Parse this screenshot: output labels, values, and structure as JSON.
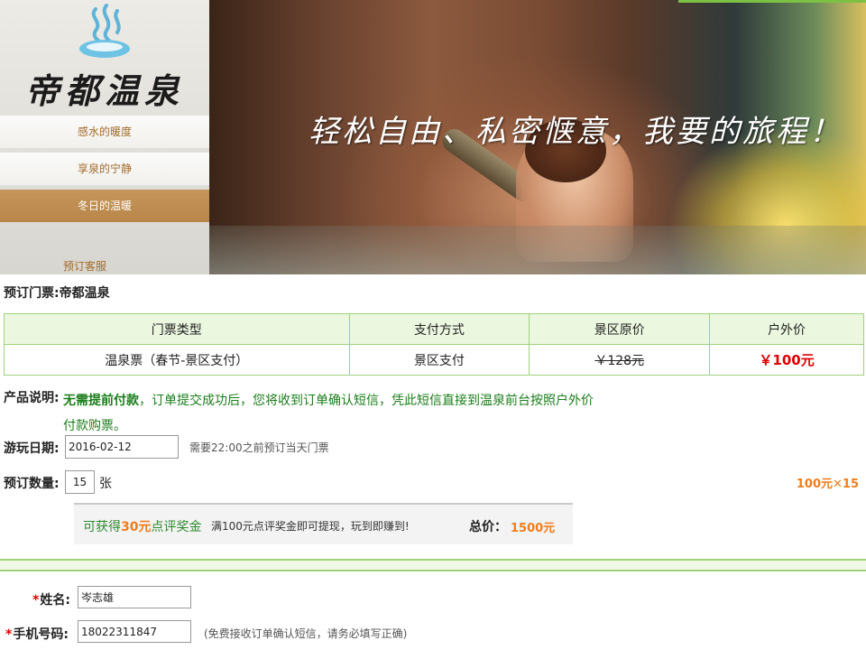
{
  "header": {
    "brand": "帝都温泉",
    "slogan": "轻松自由、私密惬意，我要的旅程！",
    "nav": [
      {
        "label": "感水的暖度",
        "active": false
      },
      {
        "label": "享泉的宁静",
        "active": false
      },
      {
        "label": "冬日的温暖",
        "active": true
      }
    ],
    "service_link": "预订客服"
  },
  "booking": {
    "title": "预订门票:帝都温泉",
    "table": {
      "headers": [
        "门票类型",
        "支付方式",
        "景区原价",
        "户外价"
      ],
      "row": {
        "ticket_type": "温泉票（春节-景区支付）",
        "payment": "景区支付",
        "original_price": "￥128元",
        "outdoor_price": "￥100元"
      }
    },
    "description": {
      "label": "产品说明:",
      "highlight": "无需提前付款",
      "text": "，订单提交成功后，您将收到订单确认短信，凭此短信直接到温泉前台按照户外价付款购票。"
    },
    "date": {
      "label": "游玩日期:",
      "value": "2016-02-12",
      "hint": "需要22:00之前预订当天门票"
    },
    "quantity": {
      "label": "预订数量:",
      "value": "15",
      "unit": "张",
      "calc": "100元✕15"
    },
    "reward": {
      "prefix": "可获得",
      "amount": "30元",
      "suffix": "点评奖金",
      "note": "满100元点评奖金即可提现，玩到即赚到!",
      "total_label": "总价：",
      "total_value": "1500元"
    }
  },
  "contact": {
    "name": {
      "label": "姓名:",
      "value": "岑志雄"
    },
    "phone": {
      "label": "手机号码:",
      "value": "18022311847",
      "hint": "(免费接收订单确认短信，请务必填写正确)"
    }
  },
  "colors": {
    "accent_green": "#9fd27a",
    "nav_active": "#b88649",
    "price_red": "#e00000",
    "orange": "#f07d1a"
  }
}
